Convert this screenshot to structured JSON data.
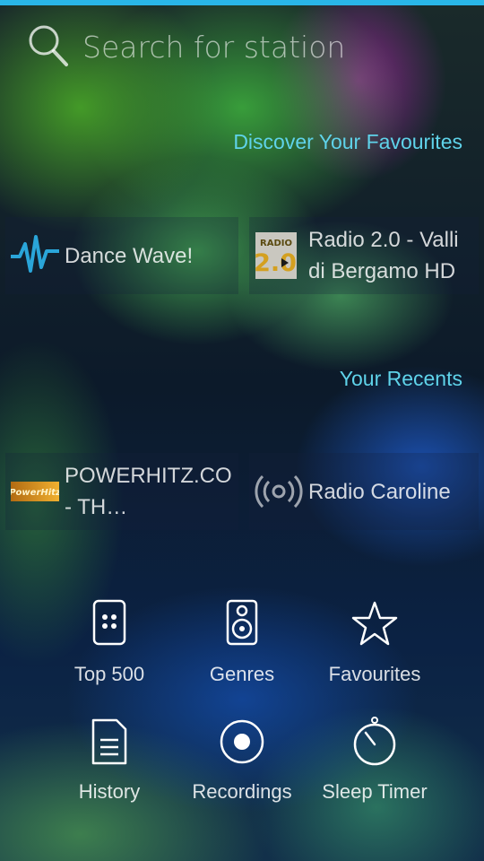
{
  "search": {
    "placeholder": "Search for station",
    "icon": "search-icon"
  },
  "colors": {
    "accent": "#29b6e8",
    "section_title": "#5fd3ea"
  },
  "favourites": {
    "title": "Discover Your Favourites",
    "items": [
      {
        "name": "Dance Wave!",
        "icon": "dance-wave-logo"
      },
      {
        "name": "Radio 2.0 - Valli di Bergamo HD",
        "icon": "radio-2-0-logo",
        "logo_text": "RADIO 2.0"
      }
    ]
  },
  "recents": {
    "title": "Your Recents",
    "items": [
      {
        "name": "POWERHITZ.COM - TH…",
        "icon": "powerhitz-logo",
        "logo_text": "PowerHitz"
      },
      {
        "name": "Radio Caroline",
        "icon": "broadcast-icon"
      }
    ]
  },
  "menu": [
    {
      "label": "Top 500",
      "icon": "dice-icon"
    },
    {
      "label": "Genres",
      "icon": "speaker-icon"
    },
    {
      "label": "Favourites",
      "icon": "star-icon"
    },
    {
      "label": "History",
      "icon": "document-icon"
    },
    {
      "label": "Recordings",
      "icon": "record-icon"
    },
    {
      "label": "Sleep Timer",
      "icon": "timer-icon"
    }
  ]
}
